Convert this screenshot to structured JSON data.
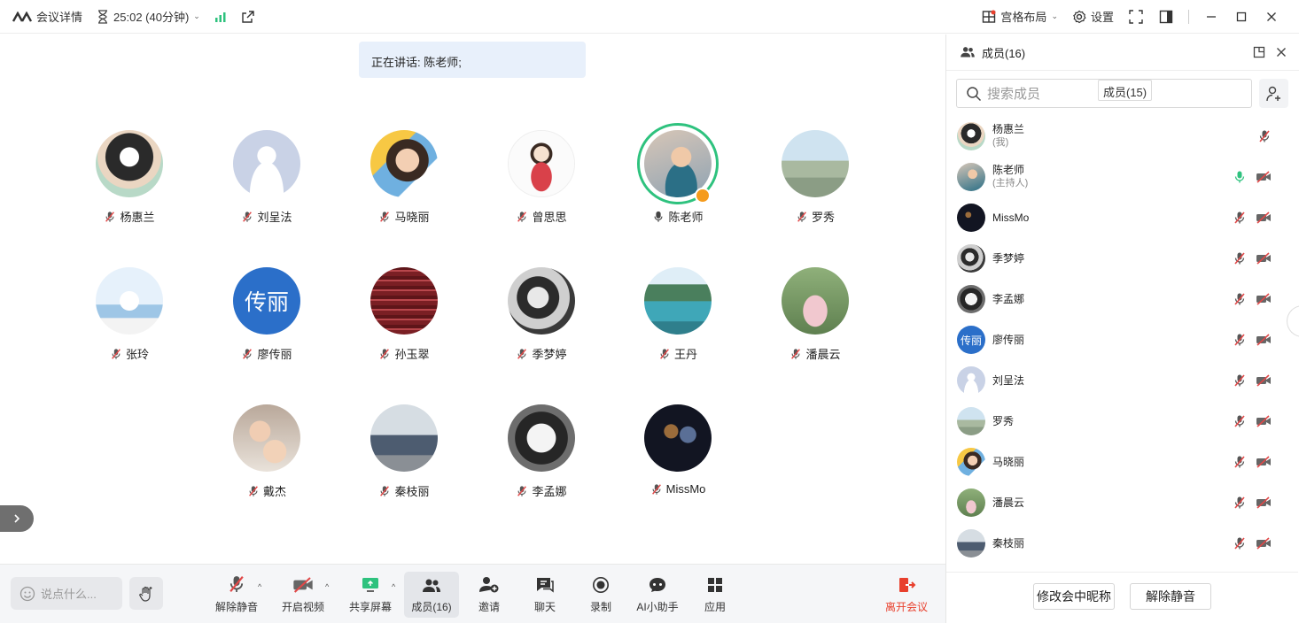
{
  "titlebar": {
    "meeting_details": "会议详情",
    "timer": "25:02 (40分钟)",
    "layout": "宫格布局",
    "settings": "设置"
  },
  "stage": {
    "speaking_text": "正在讲话: 陈老师;",
    "participants": [
      {
        "name": "杨惠兰",
        "avatar": "anime-girl"
      },
      {
        "name": "刘呈法",
        "avatar": "default"
      },
      {
        "name": "马晓丽",
        "avatar": "child-photo"
      },
      {
        "name": "曾思思",
        "avatar": "cartoon-girl"
      },
      {
        "name": "陈老师",
        "avatar": "kid-photo",
        "speaking": true
      },
      {
        "name": "罗秀",
        "avatar": "road-photo"
      },
      {
        "name": "张玲",
        "avatar": "sky-girl"
      },
      {
        "name": "廖传丽",
        "avatar_text": "传丽"
      },
      {
        "name": "孙玉翠",
        "avatar": "text-collage"
      },
      {
        "name": "季梦婷",
        "avatar": "bw-portrait"
      },
      {
        "name": "王丹",
        "avatar": "lake-photo"
      },
      {
        "name": "潘晨云",
        "avatar": "field-photo"
      },
      {
        "name": "戴杰",
        "avatar": "family-photo"
      },
      {
        "name": "秦枝丽",
        "avatar": "group-photo"
      },
      {
        "name": "李孟娜",
        "avatar": "cat-photo"
      },
      {
        "name": "MissMo",
        "avatar": "dark-poster"
      }
    ]
  },
  "bottombar": {
    "chat_placeholder": "说点什么...",
    "unmute": "解除静音",
    "video": "开启视频",
    "share": "共享屏幕",
    "members": "成员(16)",
    "invite": "邀请",
    "chat": "聊天",
    "record": "录制",
    "ai": "AI小助手",
    "apps": "应用",
    "leave": "离开会议"
  },
  "panel": {
    "title": "成员(16)",
    "search_placeholder": "搜索成员",
    "tooltip": "成员(15)",
    "members": [
      {
        "name": "杨惠兰",
        "sub": "(我)",
        "mic_on": false,
        "video": false
      },
      {
        "name": "陈老师",
        "sub": "(主持人)",
        "mic_on": true,
        "video": true
      },
      {
        "name": "MissMo",
        "sub": "",
        "mic_on": false,
        "video": true
      },
      {
        "name": "季梦婷",
        "sub": "",
        "mic_on": false,
        "video": true
      },
      {
        "name": "李孟娜",
        "sub": "",
        "mic_on": false,
        "video": true
      },
      {
        "name": "廖传丽",
        "sub": "",
        "mic_on": false,
        "video": true
      },
      {
        "name": "刘呈法",
        "sub": "",
        "mic_on": false,
        "video": true
      },
      {
        "name": "罗秀",
        "sub": "",
        "mic_on": false,
        "video": true
      },
      {
        "name": "马晓丽",
        "sub": "",
        "mic_on": false,
        "video": true
      },
      {
        "name": "潘晨云",
        "sub": "",
        "mic_on": false,
        "video": true
      },
      {
        "name": "秦枝丽",
        "sub": "",
        "mic_on": false,
        "video": true
      }
    ],
    "rename_button": "修改会中昵称",
    "unmute_button": "解除静音"
  },
  "colors": {
    "accent_green": "#2ec27e",
    "leave_red": "#e8402d",
    "muted_red": "#e04848",
    "avatar_blue": "#2b6fc9"
  }
}
